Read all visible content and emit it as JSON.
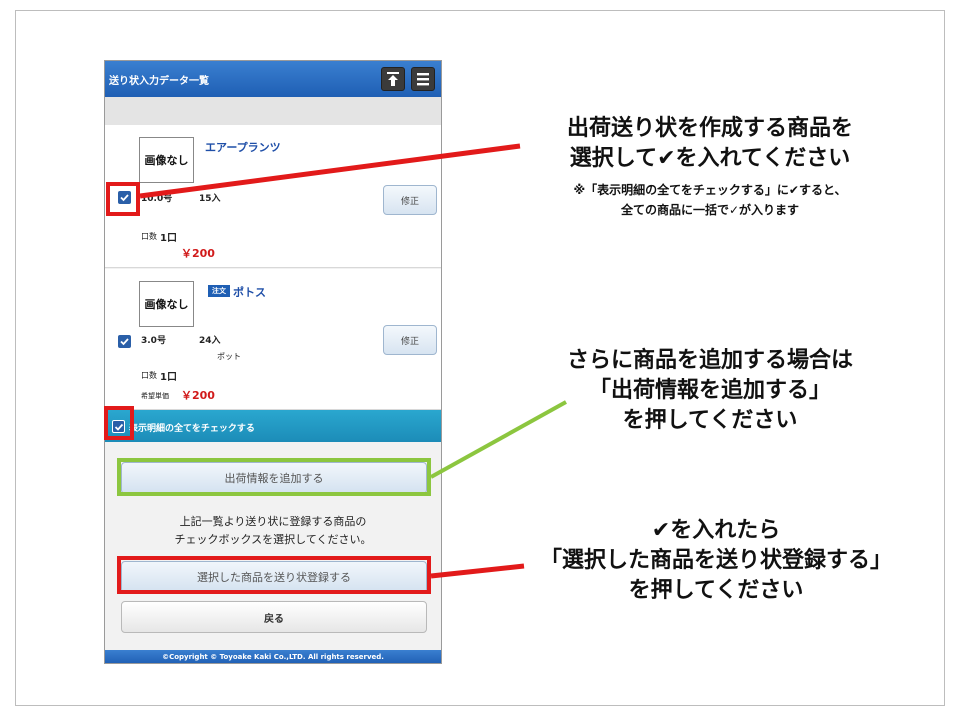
{
  "phone": {
    "title": "送り状入力データ一覧",
    "items": [
      {
        "image_placeholder": "画像なし",
        "name": "エアープランツ",
        "size": "10.0号",
        "count": "15入",
        "unit_label": "口数",
        "units": "1口",
        "price": "￥200",
        "edit_label": "修正"
      },
      {
        "image_placeholder": "画像なし",
        "badge": "注文",
        "name": "ポトス",
        "size": "3.0号",
        "count": "24入",
        "pot": "ポット",
        "unit_label": "口数",
        "units": "1口",
        "price_label": "希望単価",
        "price": "￥200",
        "edit_label": "修正"
      }
    ],
    "check_all_label": "表示明細の全てをチェックする",
    "add_button": "出荷情報を追加する",
    "instruction_line1": "上記一覧より送り状に登録する商品の",
    "instruction_line2": "チェックボックスを選択してください。",
    "register_button": "選択した商品を送り状登録する",
    "back_button": "戻る",
    "footer": "©Copyright © Toyoake Kaki Co.,LTD. All rights reserved."
  },
  "callouts": {
    "select": {
      "line1": "出荷送り状を作成する商品を",
      "line2": "選択して✔を入れてください",
      "note1": "※「表示明細の全てをチェックする」に✔すると、",
      "note2": "全ての商品に一括で✓が入ります"
    },
    "add": {
      "line1": "さらに商品を追加する場合は",
      "line2": "「出荷情報を追加する」",
      "line3": "を押してください"
    },
    "register": {
      "line1": "✔を入れたら",
      "line2": "「選択した商品を送り状登録する」",
      "line3": "を押してください"
    }
  },
  "colors": {
    "highlight_red": "#e21a1a",
    "highlight_green": "#8cc63f",
    "header_blue": "#1f5fb4",
    "check_all_bar": "#1c8cb8",
    "price_red": "#d11a1a"
  }
}
